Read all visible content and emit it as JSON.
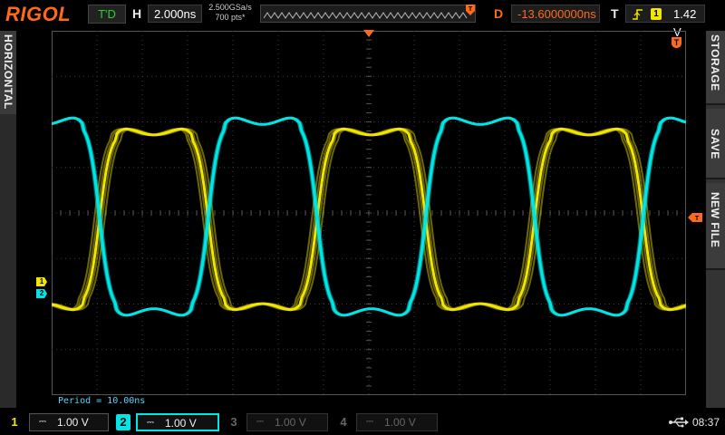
{
  "top": {
    "logo": "RIGOL",
    "run_status": "T'D",
    "horizontal_label": "H",
    "timebase": "2.000ns",
    "sample_rate": "2.500GSa/s",
    "memory_depth": "700 pts*",
    "delay_label": "D",
    "delay": "-13.6000000ns",
    "trigger_label": "T",
    "trigger_source": "1",
    "trigger_level": "1.42 V"
  },
  "left_panel": {
    "label": "HORIZONTAL"
  },
  "right_panel": {
    "items": [
      "STORAGE",
      "SAVE",
      "NEW FILE"
    ]
  },
  "measurement": {
    "period": "Period = 10.00ns"
  },
  "channels": [
    {
      "number": "1",
      "coupling": "⎓",
      "scale": "1.00 V",
      "color": "#f2e600",
      "active": true
    },
    {
      "number": "2",
      "coupling": "⎓",
      "scale": "1.00 V",
      "color": "#00e6e6",
      "active": true,
      "selected": true
    },
    {
      "number": "3",
      "coupling": "⎓",
      "scale": "1.00 V",
      "color": "#666666",
      "active": false
    },
    {
      "number": "4",
      "coupling": "⎓",
      "scale": "1.00 V",
      "color": "#666666",
      "active": false
    }
  ],
  "marker_labels": {
    "ch1": "1",
    "ch2": "2",
    "trigger_marker": "T"
  },
  "status": {
    "time": "08:37"
  },
  "colors": {
    "accent": "#ff6a1a",
    "ch1": "#f2e600",
    "ch2": "#00e6e6",
    "grid": "#3a3a3a"
  }
}
